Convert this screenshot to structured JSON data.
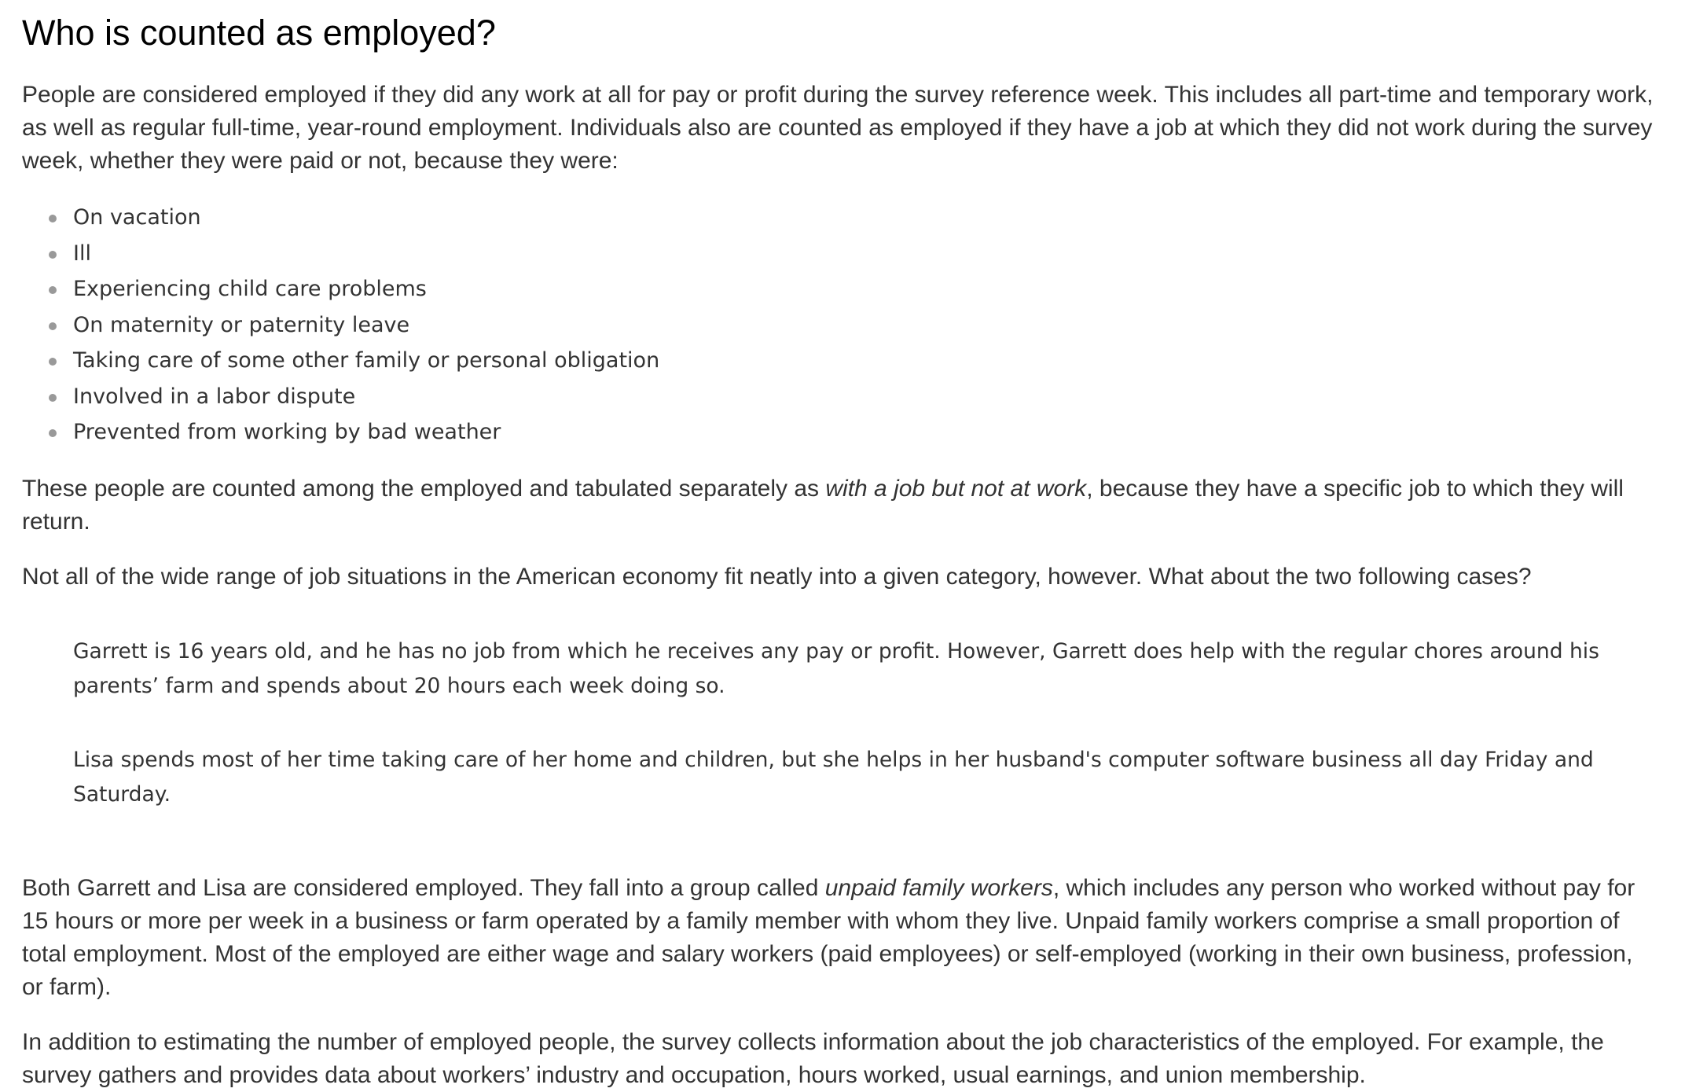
{
  "title": "Who is counted as employed?",
  "intro": "People are considered employed if they did any work at all for pay or profit during the survey reference week. This includes all part-time and temporary work, as well as regular full-time, year-round employment. Individuals also are counted as employed if they have a job at which they did not work during the survey week, whether they were paid or not, because they were:",
  "reasons": [
    "On vacation",
    "Ill",
    "Experiencing child care problems",
    "On maternity or paternity leave",
    "Taking care of some other family or personal obligation",
    "Involved in a labor dispute",
    "Prevented from working by bad weather"
  ],
  "tabulated": {
    "before": "These people are counted among the employed and tabulated separately as ",
    "emphasis": "with a job but not at work",
    "after": ", because they have a specific job to which they will return."
  },
  "not_all": "Not all of the wide range of job situations in the American economy fit neatly into a given category, however. What about the two following cases?",
  "cases": {
    "garrett": "Garrett is 16 years old, and he has no job from which he receives any pay or profit. However, Garrett does help with the regular chores around his parents’ farm and spends about 20 hours each week doing so.",
    "lisa": "Lisa spends most of her time taking care of her home and children, but she helps in her husband's computer software business all day Friday and Saturday."
  },
  "both": {
    "before": "Both Garrett and Lisa are considered employed. They fall into a group called ",
    "emphasis": "unpaid family workers",
    "after": ", which includes any person who worked without pay for 15 hours or more per week in a business or farm operated by a family member with whom they live. Unpaid family workers comprise a small proportion of total employment. Most of the employed are either wage and salary workers (paid employees) or self-employed (working in their own business, profession, or farm)."
  },
  "addition": "In addition to estimating the number of employed people, the survey collects information about the job characteristics of the employed. For example, the survey gathers and provides data about workers’ industry and occupation, hours worked, usual earnings, and union membership."
}
